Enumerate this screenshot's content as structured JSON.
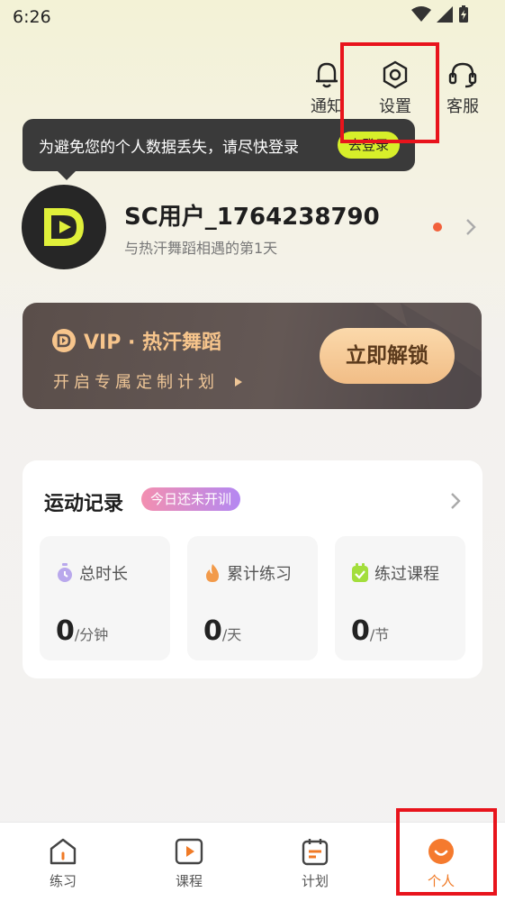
{
  "status_bar": {
    "time": "6:26"
  },
  "top_actions": {
    "notify_label": "通知",
    "settings_label": "设置",
    "service_label": "客服"
  },
  "tooltip": {
    "message": "为避免您的个人数据丢失，请尽快登录",
    "login_label": "去登录"
  },
  "profile": {
    "username": "SC用户_1764238790",
    "subtitle": "与热汗舞蹈相遇的第1天"
  },
  "vip": {
    "title": "VIP · 热汗舞蹈",
    "subtitle": "开启专属定制计划",
    "button": "立即解锁"
  },
  "records": {
    "title": "运动记录",
    "badge": "今日还未开训",
    "stats": [
      {
        "label": "总时长",
        "value": "0",
        "unit": "/分钟",
        "icon": "timer-icon"
      },
      {
        "label": "累计练习",
        "value": "0",
        "unit": "/天",
        "icon": "flame-icon"
      },
      {
        "label": "练过课程",
        "value": "0",
        "unit": "/节",
        "icon": "check-icon"
      }
    ]
  },
  "bottom_nav": {
    "items": [
      {
        "label": "练习",
        "icon": "home-icon"
      },
      {
        "label": "课程",
        "icon": "play-icon"
      },
      {
        "label": "计划",
        "icon": "calendar-icon"
      },
      {
        "label": "个人",
        "icon": "profile-icon",
        "active": true
      }
    ]
  },
  "colors": {
    "accent_orange": "#f07a26",
    "highlight_red": "#e8141c",
    "brand_green": "#d7ef2a"
  }
}
